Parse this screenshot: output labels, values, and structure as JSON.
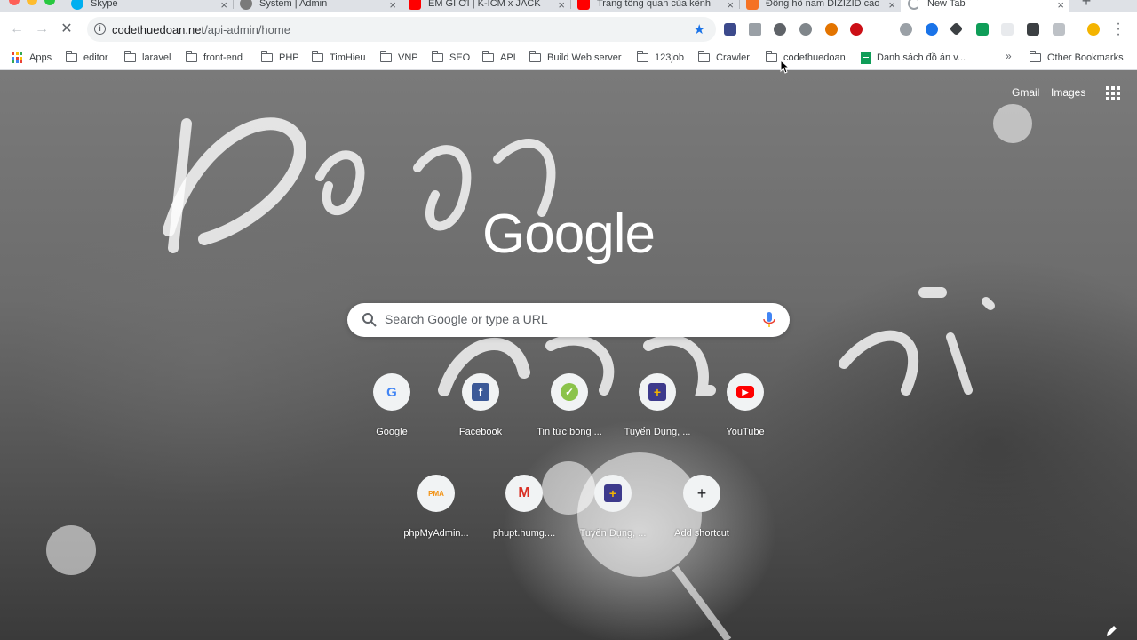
{
  "tabs": [
    {
      "title": "Skype",
      "favicon": "skype-icon",
      "color": "#00aff0"
    },
    {
      "title": "System | Admin",
      "favicon": "github-icon",
      "color": "#7a7a7a"
    },
    {
      "title": "EM GÌ ƠI | K-ICM x JACK",
      "favicon": "youtube-icon",
      "color": "#ff0000"
    },
    {
      "title": "Trang tổng quan của kênh",
      "favicon": "youtube-icon",
      "color": "#ff0000"
    },
    {
      "title": "Đồng hồ nam DIZIZID cao",
      "favicon": "shop-icon",
      "color": "#f57224"
    },
    {
      "title": "New Tab",
      "favicon": "loading-icon",
      "color": "#9aa0a6"
    }
  ],
  "toolbar": {
    "url_host": "codethuedoan.net",
    "url_path": "/api-admin/home",
    "star": "bookmark-star-icon"
  },
  "bookmarks": {
    "apps": "Apps",
    "items": [
      "editor",
      "laravel",
      "front-end",
      "PHP",
      "TimHieu",
      "VNP",
      "SEO",
      "API",
      "Build Web server",
      "123job",
      "Crawler",
      "codethuedoan"
    ],
    "sheet": "Danh sách đồ án v...",
    "overflow": "»",
    "other": "Other Bookmarks"
  },
  "ntp": {
    "gmail": "Gmail",
    "images": "Images",
    "logo": "Google",
    "search_placeholder": "Search Google or type a URL",
    "shortcuts": [
      {
        "label": "Google",
        "icon": "google-icon",
        "glyph": "G",
        "color": "#4285f4"
      },
      {
        "label": "Facebook",
        "icon": "facebook-icon",
        "glyph": "f",
        "color": "#3b5998"
      },
      {
        "label": "Tin tức bóng ...",
        "icon": "news-icon",
        "glyph": "✓",
        "color": "#8bc34a"
      },
      {
        "label": "Tuyển Dụng, ...",
        "icon": "job-icon",
        "glyph": "+",
        "color": "#3d3a8c"
      },
      {
        "label": "YouTube",
        "icon": "youtube-icon",
        "glyph": "▶",
        "color": "#ff0000"
      },
      {
        "label": "phpMyAdmin...",
        "icon": "phpmyadmin-icon",
        "glyph": "PMA",
        "color": "#f29111"
      },
      {
        "label": "phupt.humg....",
        "icon": "gmail-icon",
        "glyph": "M",
        "color": "#d93025"
      },
      {
        "label": "Tuyển Dụng, ...",
        "icon": "job-icon",
        "glyph": "+",
        "color": "#3d3a8c"
      },
      {
        "label": "Add shortcut",
        "icon": "plus-icon",
        "glyph": "+",
        "color": "#202124"
      }
    ]
  }
}
